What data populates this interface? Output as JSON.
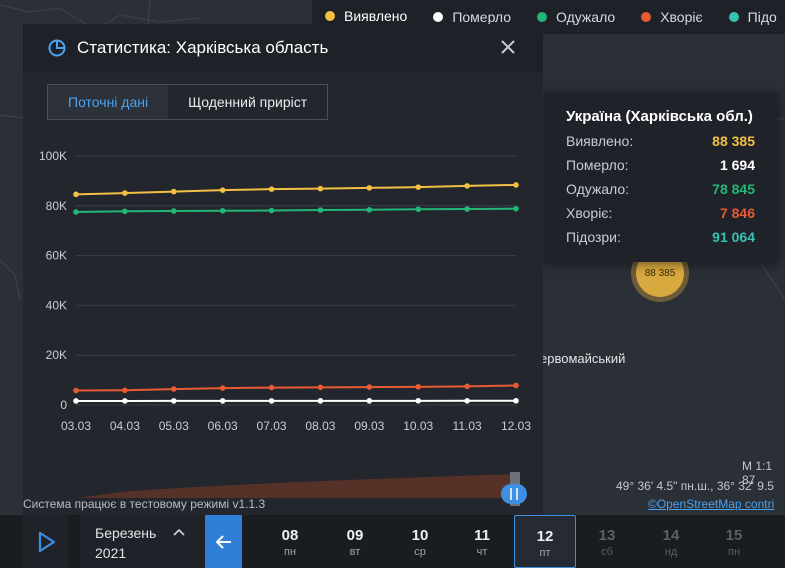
{
  "legend": [
    {
      "label": "Виявлено",
      "color": "#f2c043",
      "active": true
    },
    {
      "label": "Померло",
      "color": "#ffffff",
      "active": false
    },
    {
      "label": "Одужало",
      "color": "#22b776",
      "active": false
    },
    {
      "label": "Хворіє",
      "color": "#ea5a33",
      "active": false
    },
    {
      "label": "Підо",
      "color": "#35c2b0",
      "active": false
    }
  ],
  "panel": {
    "title": "Статистика: Харківська область",
    "tabs": [
      {
        "label": "Поточні дані",
        "active": true
      },
      {
        "label": "Щоденний приріст",
        "active": false
      }
    ],
    "status_note": "Система працює в тестовому режимі v1.1.3"
  },
  "chart_data": {
    "type": "line",
    "categories": [
      "03.03",
      "04.03",
      "05.03",
      "06.03",
      "07.03",
      "08.03",
      "09.03",
      "10.03",
      "11.03",
      "12.03"
    ],
    "y_ticks": [
      "0",
      "20K",
      "40K",
      "60K",
      "80K",
      "100K"
    ],
    "ylim": [
      0,
      100000
    ],
    "grid": true,
    "series": [
      {
        "color": "#f2c043",
        "values": [
          84600,
          85100,
          85700,
          86300,
          86700,
          86900,
          87200,
          87500,
          88000,
          88385
        ]
      },
      {
        "color": "#22b776",
        "values": [
          77500,
          77800,
          77900,
          78000,
          78100,
          78300,
          78400,
          78600,
          78700,
          78845
        ]
      },
      {
        "color": "#ea5a33",
        "values": [
          5800,
          5900,
          6400,
          6800,
          7000,
          7100,
          7200,
          7300,
          7500,
          7846
        ]
      },
      {
        "color": "#ffffff",
        "values": [
          1620,
          1630,
          1640,
          1650,
          1660,
          1665,
          1670,
          1680,
          1688,
          1694
        ]
      }
    ]
  },
  "tooltip": {
    "title": "Україна (Харківська обл.)",
    "rows": [
      {
        "label": "Виявлено:",
        "value": "88 385",
        "color": "#f2c043"
      },
      {
        "label": "Померло:",
        "value": "1 694",
        "color": "#ffffff"
      },
      {
        "label": "Одужало:",
        "value": "78 845",
        "color": "#22b776"
      },
      {
        "label": "Хворіє:",
        "value": "7 846",
        "color": "#ea5a33"
      },
      {
        "label": "Підозри:",
        "value": "91 064",
        "color": "#35c2b0"
      }
    ]
  },
  "map": {
    "marker_value": "88 385",
    "place_label": "ервомайський",
    "scale": "М 1:1 87",
    "coords": "49° 36' 4.5\" пн.ш., 36° 32' 9.5",
    "attribution": "©OpenStreetMap contri"
  },
  "timeline": {
    "month": "Березень",
    "year": "2021",
    "days": [
      {
        "num": "08",
        "wd": "пн",
        "state": "past"
      },
      {
        "num": "09",
        "wd": "вт",
        "state": "past"
      },
      {
        "num": "10",
        "wd": "ср",
        "state": "past"
      },
      {
        "num": "11",
        "wd": "чт",
        "state": "past"
      },
      {
        "num": "12",
        "wd": "пт",
        "state": "selected"
      },
      {
        "num": "13",
        "wd": "сб",
        "state": "future"
      },
      {
        "num": "14",
        "wd": "нд",
        "state": "future"
      },
      {
        "num": "15",
        "wd": "пн",
        "state": "future"
      }
    ]
  }
}
